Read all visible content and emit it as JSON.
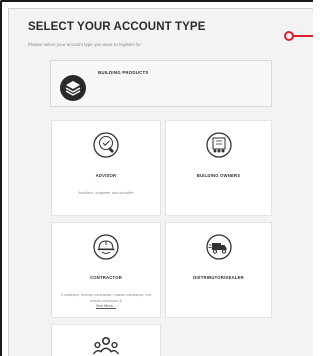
{
  "header": {
    "title": "SELECT YOUR ACCOUNT TYPE",
    "subtitle": "Please select your account type you want to register for."
  },
  "wide_card": {
    "label": "BUILDING PRODUCTS",
    "icon": "layers-icon"
  },
  "cards": [
    {
      "label": "ADVISOR",
      "desc": "Architect, engineer and specifier",
      "icon": "stamp-check-icon"
    },
    {
      "label": "BUILDING OWNERS",
      "desc": "",
      "icon": "building-people-icon"
    },
    {
      "label": "CONTRACTOR",
      "desc": "Contractor, license contractor, master contractor, red shield contractor &",
      "more": "See More...",
      "icon": "hard-hat-icon"
    },
    {
      "label": "DISTRIBUTOR/DEALER",
      "desc": "",
      "icon": "delivery-truck-icon"
    },
    {
      "label": "",
      "desc": "",
      "icon": "group-people-icon"
    }
  ],
  "colors": {
    "pointer": "#e0202c",
    "frame": "#1a1a1a",
    "panel_bg": "#f3f3f3"
  }
}
